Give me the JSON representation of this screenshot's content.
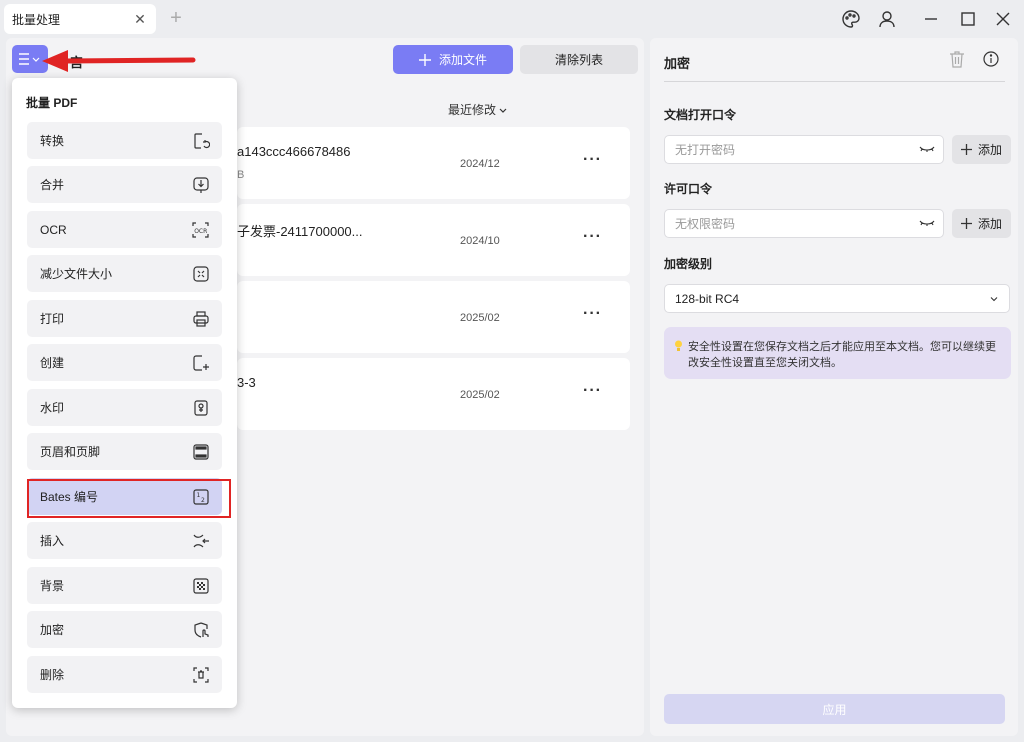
{
  "titlebar": {
    "tab_label": "批量处理",
    "tab_close": "✕",
    "tab_add": "+"
  },
  "toolbar": {
    "title": "宫",
    "add_file_label": "添加文件",
    "clear_list_label": "清除列表",
    "sort_label": "最近修改"
  },
  "files": [
    {
      "name": "a143ccc466678486",
      "sub": "B",
      "date": "2024/12",
      "more": "···"
    },
    {
      "name": "子发票-2411700000...",
      "sub": "",
      "date": "2024/10",
      "more": "···"
    },
    {
      "name": "",
      "sub": "",
      "date": "2025/02",
      "more": "···"
    },
    {
      "name": "3-3",
      "sub": "",
      "date": "2025/02",
      "more": "···"
    }
  ],
  "dropdown": {
    "title": "批量 PDF",
    "items": [
      {
        "label": "转换",
        "icon": "convert-icon"
      },
      {
        "label": "合并",
        "icon": "merge-icon"
      },
      {
        "label": "OCR",
        "icon": "ocr-icon"
      },
      {
        "label": "减少文件大小",
        "icon": "compress-icon"
      },
      {
        "label": "打印",
        "icon": "printer-icon"
      },
      {
        "label": "创建",
        "icon": "create-icon"
      },
      {
        "label": "水印",
        "icon": "watermark-icon"
      },
      {
        "label": "页眉和页脚",
        "icon": "header-footer-icon"
      },
      {
        "label": "Bates 编号",
        "icon": "bates-icon",
        "active": true
      },
      {
        "label": "插入",
        "icon": "insert-icon"
      },
      {
        "label": "背景",
        "icon": "background-icon"
      },
      {
        "label": "加密",
        "icon": "encrypt-icon"
      },
      {
        "label": "删除",
        "icon": "delete-page-icon"
      }
    ]
  },
  "right_panel": {
    "title": "加密",
    "open_password_label": "文档打开口令",
    "open_password_placeholder": "无打开密码",
    "permission_password_label": "许可口令",
    "permission_password_placeholder": "无权限密码",
    "add_label": "添加",
    "level_label": "加密级别",
    "level_value": "128-bit RC4",
    "info_text": "安全性设置在您保存文档之后才能应用至本文档。您可以继续更改安全性设置直至您关闭文档。",
    "apply_label": "应用"
  },
  "colors": {
    "accent": "#7a7cf4",
    "annotation_red": "#e02424",
    "active_item": "#d2d3f3",
    "info_bg": "#e4def3"
  }
}
